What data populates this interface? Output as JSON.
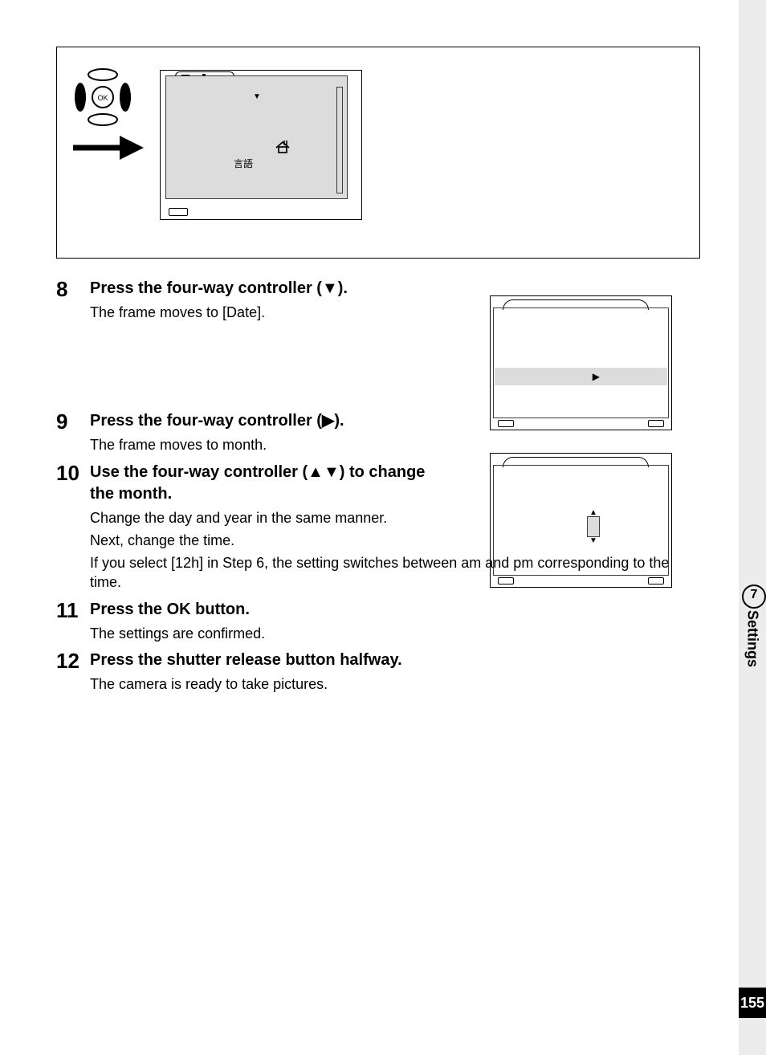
{
  "page_number": "155",
  "side_tab": {
    "number": "7",
    "label": "Settings"
  },
  "figure": {
    "language_label": "言語"
  },
  "steps": {
    "s8": {
      "num": "8",
      "title_pre": "Press the four-way controller (",
      "title_post": ").",
      "body": "The frame moves to [Date]."
    },
    "s9": {
      "num": "9",
      "title_pre": "Press the four-way controller (",
      "title_post": ").",
      "body": "The frame moves to month."
    },
    "s10": {
      "num": "10",
      "title_pre": "Use the four-way controller (",
      "title_post": ") to change the month.",
      "body1": "Change the day and year in the same manner.",
      "body2": "Next, change the time.",
      "body3": "If you select [12h] in Step 6, the setting switches between am and pm corresponding to the time."
    },
    "s11": {
      "num": "11",
      "title": "Press the OK button.",
      "body": "The settings are confirmed."
    },
    "s12": {
      "num": "12",
      "title": "Press the shutter release button halfway.",
      "body": "The camera is ready to take pictures."
    }
  },
  "glyphs": {
    "down": "▼",
    "right": "▶",
    "up": "▲"
  }
}
